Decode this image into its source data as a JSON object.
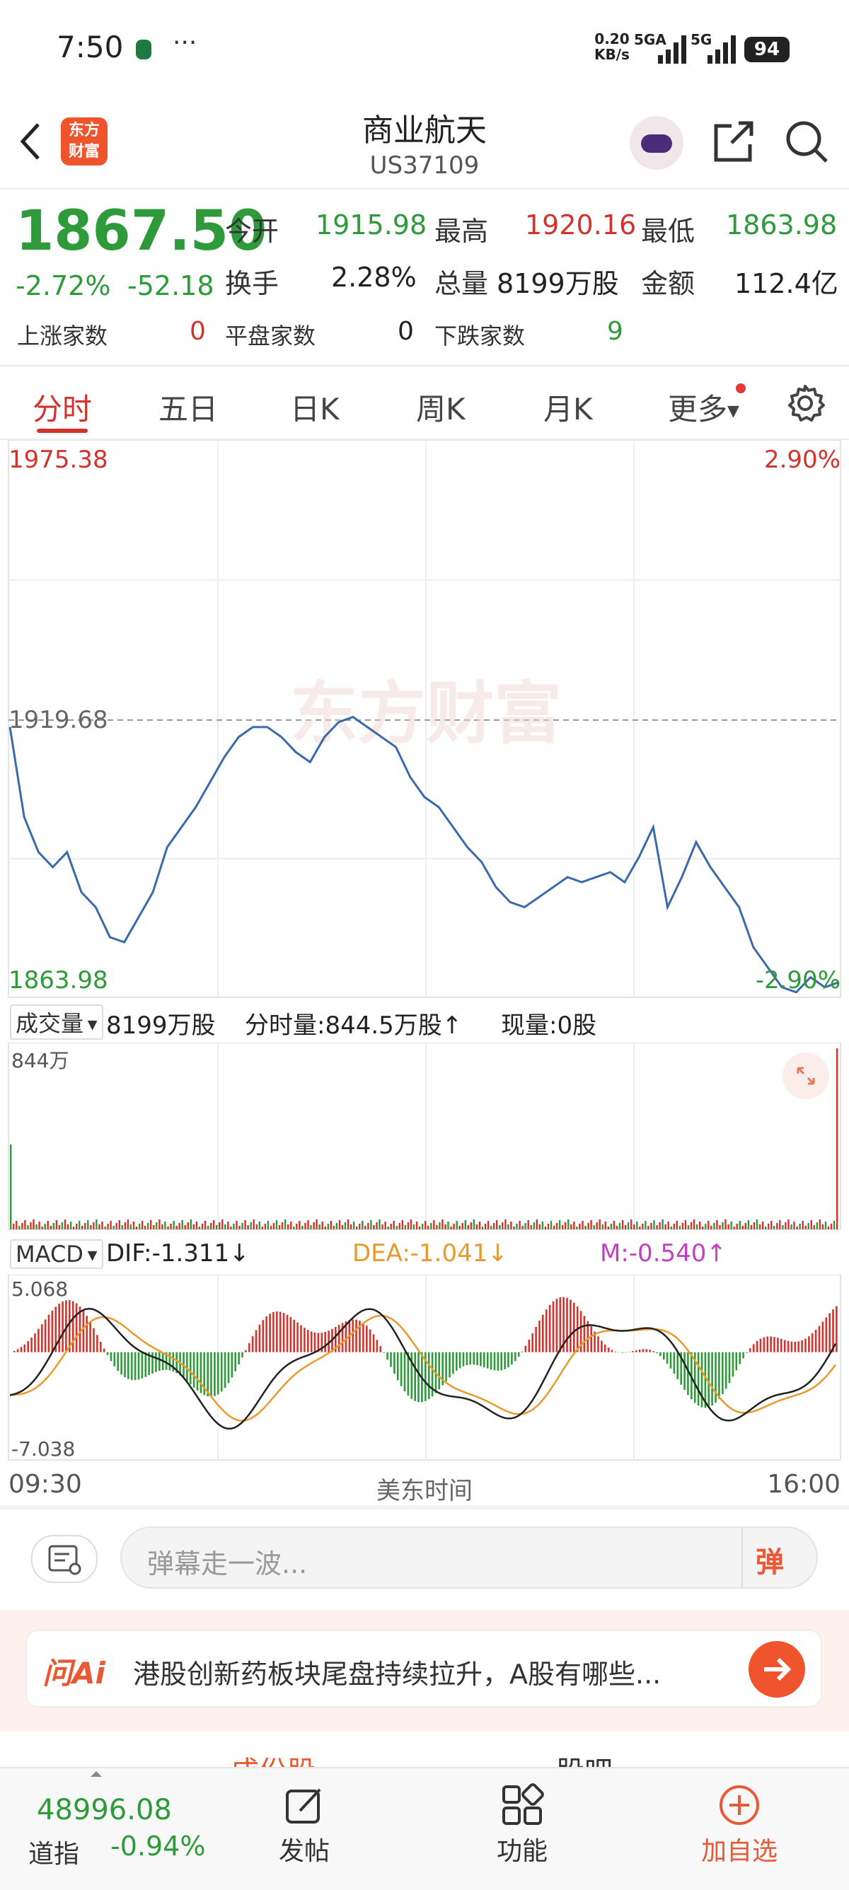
{
  "status_bar": {
    "time": "7:50",
    "net_speed_top": "0.20",
    "net_speed_bottom": "KB/s",
    "signal1": "5GA",
    "signal2": "5G",
    "battery": "94"
  },
  "header": {
    "title": "商业航天",
    "code": "US37109",
    "logo_text_1": "东方",
    "logo_text_2": "财富"
  },
  "quote": {
    "price": "1867.50",
    "change_pct": "-2.72%",
    "change": "-52.18",
    "open_label": "今开",
    "open": "1915.98",
    "high_label": "最高",
    "high": "1920.16",
    "low_label": "最低",
    "low": "1863.98",
    "turnover_label": "换手",
    "turnover": "2.28%",
    "volume_label": "总量",
    "volume": "8199万股",
    "amount_label": "金额",
    "amount": "112.4亿",
    "up_label": "上涨家数",
    "up": "0",
    "flat_label": "平盘家数",
    "flat": "0",
    "down_label": "下跌家数",
    "down": "9"
  },
  "tabs": [
    "分时",
    "五日",
    "日K",
    "周K",
    "月K",
    "更多"
  ],
  "chart": {
    "max_price": "1975.38",
    "max_pct": "2.90%",
    "ref_price": "1919.68",
    "min_price": "1863.98",
    "min_pct": "-2.90%",
    "watermark": "东方财富"
  },
  "volume_bar": {
    "selector": "成交量",
    "total": "8199万股",
    "tick_vol": "分时量:844.5万股↑",
    "now_vol": "现量:0股",
    "scale": "844万"
  },
  "macd_bar": {
    "selector": "MACD",
    "dif": "DIF:-1.311↓",
    "dea": "DEA:-1.041↓",
    "m": "M:-0.540↑",
    "top": "5.068",
    "bottom": "-7.038"
  },
  "time_axis": {
    "start": "09:30",
    "label": "美东时间",
    "end": "16:00"
  },
  "comment": {
    "placeholder": "弹幕走一波...",
    "danmu_button": "弹"
  },
  "ai_banner": {
    "logo": "问Ai",
    "text": "港股创新药板块尾盘持续拉升，A股有哪些..."
  },
  "section_tabs": {
    "left": "成份股",
    "right": "股吧"
  },
  "bottom": {
    "index_value": "48996.08",
    "index_name": "道指",
    "index_change": "-0.94%",
    "post": "发帖",
    "function": "功能",
    "add": "加自选"
  },
  "colors": {
    "up": "#d0342c",
    "down": "#2e9a3a",
    "line": "#3b6aaa",
    "accent": "#f0542d",
    "dea": "#e89a2a",
    "m": "#c23fc2"
  },
  "chart_data": {
    "type": "line",
    "title": "",
    "x": [
      "09:30",
      "16:00"
    ],
    "ylim": [
      1863.98,
      1975.38
    ],
    "prev_close": 1919.68,
    "series": [
      {
        "values": [
          1918,
          1900,
          1893,
          1890,
          1893,
          1885,
          1882,
          1876,
          1875,
          1880,
          1885,
          1894,
          1898,
          1902,
          1907,
          1912,
          1916,
          1918,
          1918,
          1916,
          1913,
          1911,
          1916,
          1919,
          1920,
          1918,
          1916,
          1914,
          1908,
          1904,
          1902,
          1898,
          1894,
          1891,
          1886,
          1883,
          1882,
          1884,
          1886,
          1888,
          1887,
          1888,
          1889,
          1887,
          1892,
          1898,
          1882,
          1888,
          1895,
          1890,
          1886,
          1882,
          1874,
          1870,
          1866,
          1865,
          1868,
          1866,
          1867
        ]
      }
    ],
    "volume_scale_max": "844万",
    "macd_range": [
      -7.038,
      5.068
    ]
  }
}
